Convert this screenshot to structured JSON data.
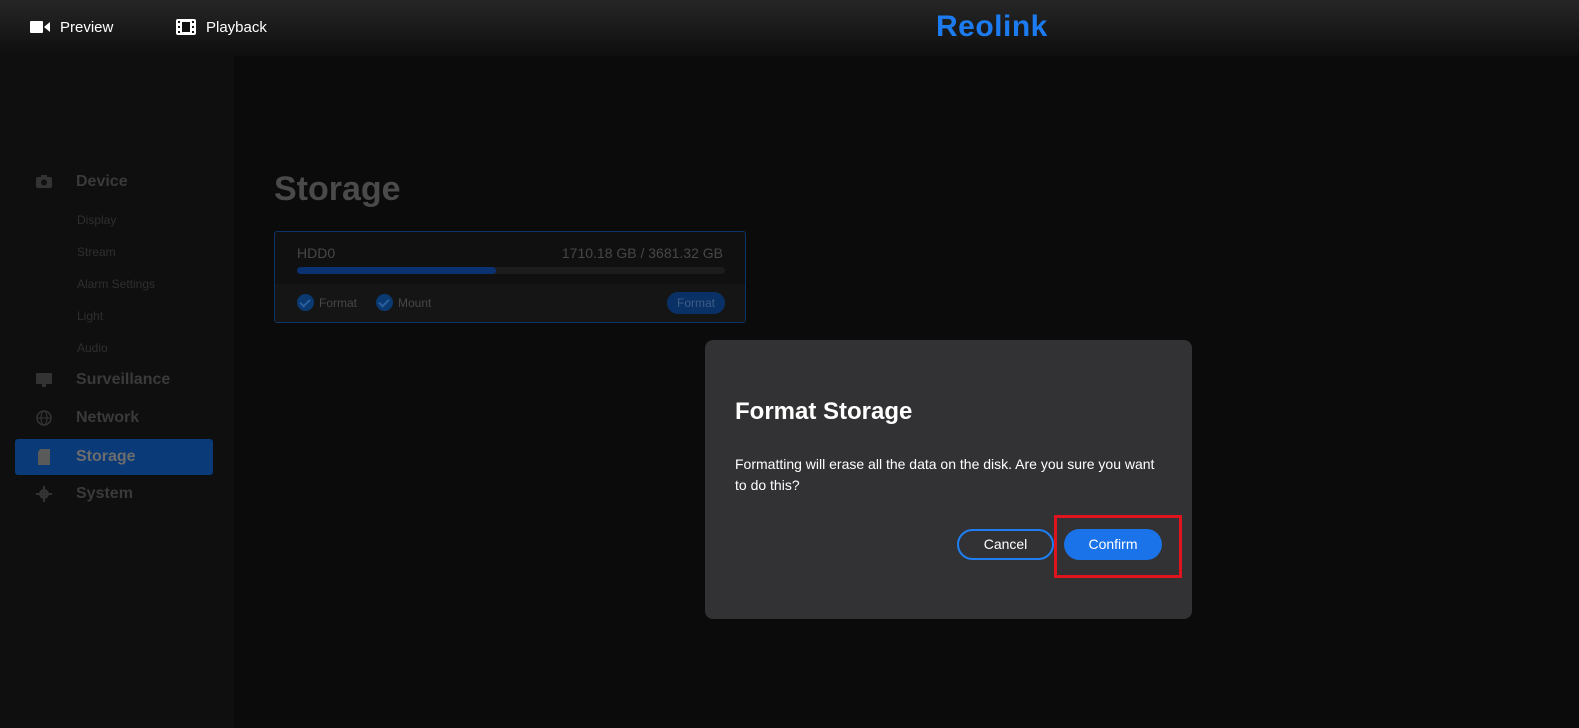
{
  "topbar": {
    "preview_label": "Preview",
    "playback_label": "Playback",
    "logo_text": "Reolink"
  },
  "sidebar": {
    "groups": [
      {
        "label": "Device",
        "icon": "camera-icon",
        "subitems": [
          "Display",
          "Stream",
          "Alarm Settings",
          "Light",
          "Audio"
        ]
      },
      {
        "label": "Surveillance",
        "icon": "monitor-icon"
      },
      {
        "label": "Network",
        "icon": "globe-icon"
      },
      {
        "label": "Storage",
        "icon": "sd-card-icon",
        "active": true
      },
      {
        "label": "System",
        "icon": "gear-icon"
      }
    ]
  },
  "main": {
    "title": "Storage",
    "disk": {
      "name": "HDD0",
      "usage_text": "1710.18 GB / 3681.32 GB",
      "used_fraction": 0.465,
      "format_check_label": "Format",
      "mount_check_label": "Mount",
      "format_button_label": "Format"
    }
  },
  "dialog": {
    "title": "Format Storage",
    "message": "Formatting will erase all the data on the disk. Are you sure you want to do this?",
    "cancel_label": "Cancel",
    "confirm_label": "Confirm"
  },
  "colors": {
    "accent": "#1a73e8",
    "highlight": "#e0141e",
    "dialog_bg": "#323234"
  }
}
